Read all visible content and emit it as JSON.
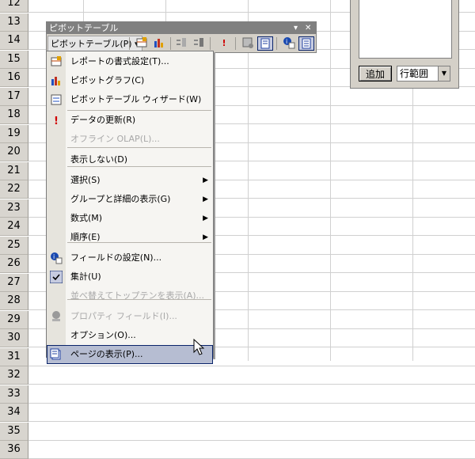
{
  "rows": [
    "12",
    "13",
    "14",
    "15",
    "16",
    "17",
    "18",
    "19",
    "20",
    "21",
    "22",
    "23",
    "24",
    "25",
    "26",
    "27",
    "28",
    "29",
    "30",
    "31",
    "32",
    "33",
    "34",
    "35",
    "36"
  ],
  "panel": {
    "add_button": "追加",
    "area_select": "行範囲"
  },
  "toolbar": {
    "title": "ピボットテーブル",
    "menu_label": "ピボットテーブル(P) ▾"
  },
  "menu": {
    "items": [
      {
        "label": "レポートの書式設定(T)...",
        "icon": "format-report-icon"
      },
      {
        "label": "ピボットグラフ(C)",
        "icon": "pivot-chart-icon"
      },
      {
        "label": "ピボットテーブル ウィザード(W)",
        "icon": "wizard-icon"
      },
      {
        "label": "データの更新(R)",
        "icon": "refresh-exclamation-icon"
      },
      {
        "label": "オフライン OLAP(L)...",
        "disabled": true
      },
      {
        "label": "表示しない(D)"
      },
      {
        "label": "選択(S)",
        "submenu": true
      },
      {
        "label": "グループと詳細の表示(G)",
        "submenu": true
      },
      {
        "label": "数式(M)",
        "submenu": true
      },
      {
        "label": "順序(E)",
        "submenu": true
      },
      {
        "label": "フィールドの設定(N)...",
        "icon": "field-settings-icon"
      },
      {
        "label": "集計(U)",
        "icon": "checkmark-icon",
        "checked": true
      },
      {
        "label": "並べ替えてトップテンを表示(A)...",
        "disabled": true
      },
      {
        "label": "プロパティ フィールド(I)...",
        "disabled": true,
        "icon": "property-field-icon"
      },
      {
        "label": "オプション(O)..."
      },
      {
        "label": "ページの表示(P)...",
        "icon": "show-pages-icon",
        "highlighted": true
      }
    ]
  }
}
